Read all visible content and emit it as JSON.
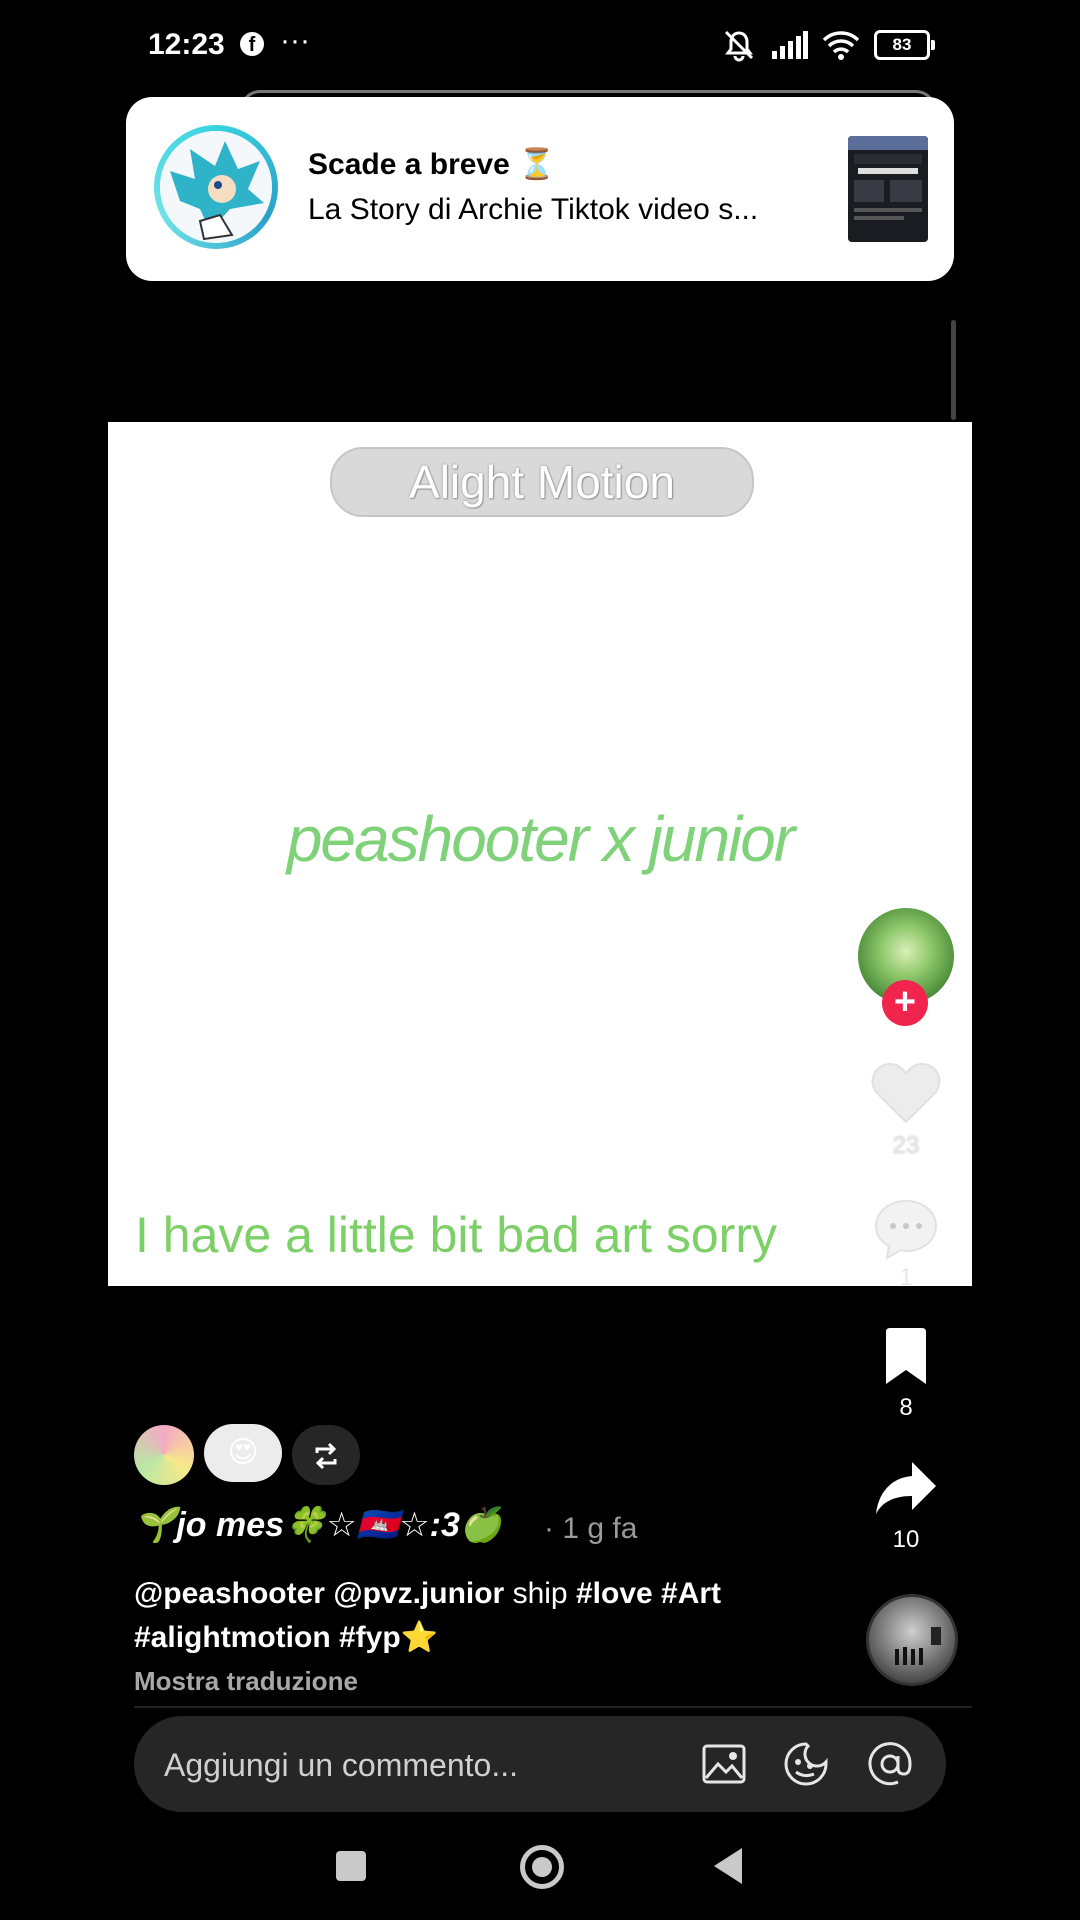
{
  "status_bar": {
    "time": "12:23",
    "more": "···",
    "battery": "83",
    "icons": [
      "facebook-icon",
      "mute-icon",
      "signal-icon",
      "wifi-icon",
      "battery-icon"
    ]
  },
  "notification": {
    "title": "Scade a breve ⏳",
    "text": "La Story di Archie Tiktok video s..."
  },
  "video": {
    "watermark": "Alight Motion",
    "title": "peashooter x junior",
    "caption": "I have a little bit bad art sorry"
  },
  "rail": {
    "likes": "23",
    "comments": "1",
    "saves": "8",
    "shares": "10"
  },
  "post": {
    "reaction_emoji": "😍",
    "username": "🌱jo mes🍀☆🇰🇭☆:3🍏",
    "time_ago": "· 1 g fa",
    "caption_mention_1": "@peashooter",
    "caption_mention_2": "@pvz.junior",
    "caption_word": "ship",
    "caption_tag_1": "#love",
    "caption_tag_2": "#Art",
    "caption_tag_3": "#alightmotion",
    "caption_tag_4": "#fyp⭐",
    "translate": "Mostra traduzione"
  },
  "comment_bar": {
    "placeholder": "Aggiungi un commento..."
  },
  "colors": {
    "accent_follow": "#f0244d",
    "video_text_green": "#7dcf68",
    "background": "#000000"
  }
}
